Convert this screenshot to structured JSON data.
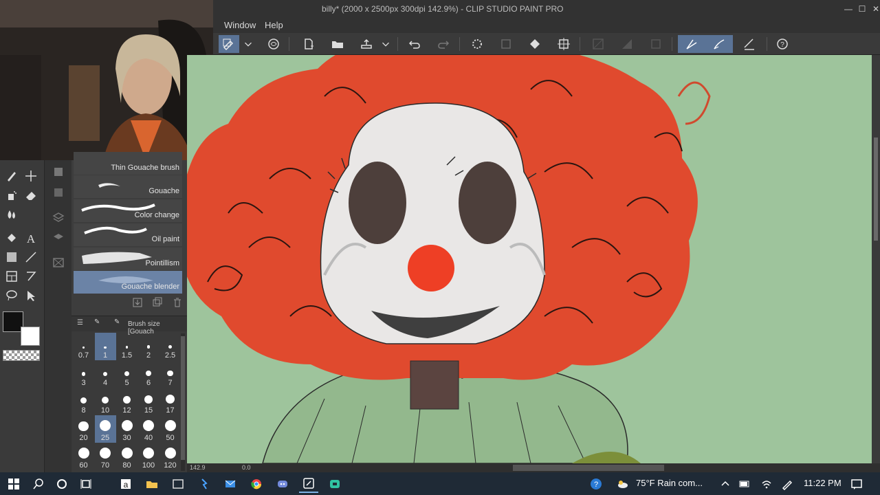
{
  "window": {
    "title": "billy* (2000 x 2500px 300dpi 142.9%) - CLIP STUDIO PAINT PRO",
    "minimize_icon": "minimize-icon",
    "maximize_icon": "maximize-icon",
    "close_icon": "close-icon"
  },
  "menu": {
    "items": [
      "Window",
      "Help"
    ]
  },
  "toolbar": {
    "icons": [
      "brush-settings-icon",
      "chevron-down-icon",
      "clip-studio-icon",
      "new-file-icon",
      "open-folder-icon",
      "export-icon",
      "chevron-down-icon",
      "undo-icon",
      "redo-icon",
      "loading-icon",
      "clear-icon",
      "fill-icon",
      "transform-icon",
      "stroke-icon",
      "fill-selection-icon",
      "selection-icon",
      "pen-active-icon",
      "brush-active-icon",
      "ruler-pen-icon",
      "help-icon"
    ]
  },
  "brushes": {
    "items": [
      {
        "label": "Thin Gouache brush",
        "selected": false
      },
      {
        "label": "Gouache",
        "selected": false
      },
      {
        "label": "Color change",
        "selected": false
      },
      {
        "label": "Oil paint",
        "selected": false
      },
      {
        "label": "Pointillism",
        "selected": false
      },
      {
        "label": "Gouache blender",
        "selected": true
      }
    ]
  },
  "brush_size": {
    "header": "Brush size [Gouach",
    "sizes": [
      "0.7",
      "1",
      "1.5",
      "2",
      "2.5",
      "3",
      "4",
      "5",
      "6",
      "7",
      "8",
      "10",
      "12",
      "15",
      "17",
      "20",
      "25",
      "30",
      "40",
      "50",
      "60",
      "70",
      "80",
      "100",
      "120"
    ],
    "selected": [
      "1",
      "25"
    ]
  },
  "status": {
    "zoom": "142.9",
    "angle": "0.0"
  },
  "taskbar": {
    "weather": "75°F  Rain com...",
    "time": "11:22 PM",
    "apps": [
      "start-icon",
      "search-icon",
      "cortana-icon",
      "task-view-icon",
      "amazon-icon",
      "file-explorer-icon",
      "browser-icon",
      "app-icon",
      "mail-icon",
      "chrome-icon",
      "discord-icon",
      "clip-studio-icon",
      "streamlabs-icon"
    ]
  },
  "colors": {
    "canvas_bg": "#9ec49c",
    "hair": "#e04a2e",
    "face": "#e9e7e6",
    "nose": "#ee3f25",
    "accent": "#5a7396",
    "main_color": "#111111",
    "sub_color": "#ffffff"
  }
}
